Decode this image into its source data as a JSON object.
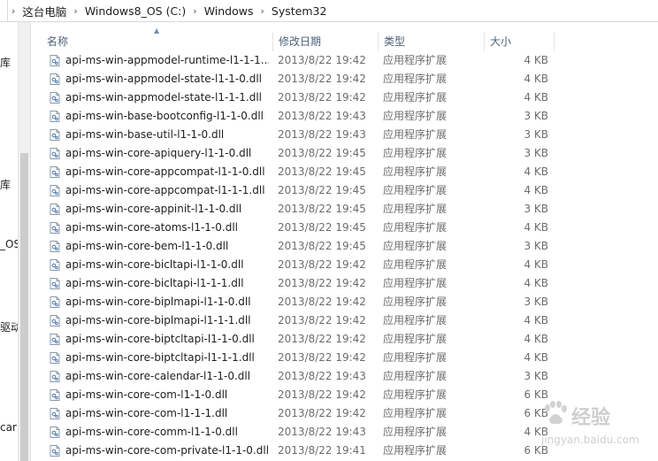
{
  "breadcrumb": [
    "这台电脑",
    "Windows8_OS (C:)",
    "Windows",
    "System32"
  ],
  "left_pane": [
    "库",
    "库",
    "_OS",
    "驱动",
    "car"
  ],
  "columns": {
    "name": "名称",
    "date": "修改日期",
    "type": "类型",
    "size": "大小"
  },
  "files": [
    {
      "name": "api-ms-win-appmodel-runtime-l1-1-1...",
      "date": "2013/8/22 19:42",
      "type": "应用程序扩展",
      "size": "4 KB"
    },
    {
      "name": "api-ms-win-appmodel-state-l1-1-0.dll",
      "date": "2013/8/22 19:42",
      "type": "应用程序扩展",
      "size": "4 KB"
    },
    {
      "name": "api-ms-win-appmodel-state-l1-1-1.dll",
      "date": "2013/8/22 19:42",
      "type": "应用程序扩展",
      "size": "4 KB"
    },
    {
      "name": "api-ms-win-base-bootconfig-l1-1-0.dll",
      "date": "2013/8/22 19:43",
      "type": "应用程序扩展",
      "size": "3 KB"
    },
    {
      "name": "api-ms-win-base-util-l1-1-0.dll",
      "date": "2013/8/22 19:43",
      "type": "应用程序扩展",
      "size": "3 KB"
    },
    {
      "name": "api-ms-win-core-apiquery-l1-1-0.dll",
      "date": "2013/8/22 19:45",
      "type": "应用程序扩展",
      "size": "3 KB"
    },
    {
      "name": "api-ms-win-core-appcompat-l1-1-0.dll",
      "date": "2013/8/22 19:45",
      "type": "应用程序扩展",
      "size": "4 KB"
    },
    {
      "name": "api-ms-win-core-appcompat-l1-1-1.dll",
      "date": "2013/8/22 19:45",
      "type": "应用程序扩展",
      "size": "4 KB"
    },
    {
      "name": "api-ms-win-core-appinit-l1-1-0.dll",
      "date": "2013/8/22 19:45",
      "type": "应用程序扩展",
      "size": "3 KB"
    },
    {
      "name": "api-ms-win-core-atoms-l1-1-0.dll",
      "date": "2013/8/22 19:45",
      "type": "应用程序扩展",
      "size": "4 KB"
    },
    {
      "name": "api-ms-win-core-bem-l1-1-0.dll",
      "date": "2013/8/22 19:45",
      "type": "应用程序扩展",
      "size": "3 KB"
    },
    {
      "name": "api-ms-win-core-bicltapi-l1-1-0.dll",
      "date": "2013/8/22 19:42",
      "type": "应用程序扩展",
      "size": "4 KB"
    },
    {
      "name": "api-ms-win-core-bicltapi-l1-1-1.dll",
      "date": "2013/8/22 19:42",
      "type": "应用程序扩展",
      "size": "4 KB"
    },
    {
      "name": "api-ms-win-core-biplmapi-l1-1-0.dll",
      "date": "2013/8/22 19:42",
      "type": "应用程序扩展",
      "size": "3 KB"
    },
    {
      "name": "api-ms-win-core-biplmapi-l1-1-1.dll",
      "date": "2013/8/22 19:42",
      "type": "应用程序扩展",
      "size": "4 KB"
    },
    {
      "name": "api-ms-win-core-biptcltapi-l1-1-0.dll",
      "date": "2013/8/22 19:42",
      "type": "应用程序扩展",
      "size": "4 KB"
    },
    {
      "name": "api-ms-win-core-biptcltapi-l1-1-1.dll",
      "date": "2013/8/22 19:42",
      "type": "应用程序扩展",
      "size": "4 KB"
    },
    {
      "name": "api-ms-win-core-calendar-l1-1-0.dll",
      "date": "2013/8/22 19:43",
      "type": "应用程序扩展",
      "size": "3 KB"
    },
    {
      "name": "api-ms-win-core-com-l1-1-0.dll",
      "date": "2013/8/22 19:42",
      "type": "应用程序扩展",
      "size": "6 KB"
    },
    {
      "name": "api-ms-win-core-com-l1-1-1.dll",
      "date": "2013/8/22 19:42",
      "type": "应用程序扩展",
      "size": "6 KB"
    },
    {
      "name": "api-ms-win-core-comm-l1-1-0.dll",
      "date": "2013/8/22 19:43",
      "type": "应用程序扩展",
      "size": "4 KB"
    },
    {
      "name": "api-ms-win-core-com-private-l1-1-0.dll",
      "date": "2013/8/22 19:41",
      "type": "应用程序扩展",
      "size": "6 KB"
    }
  ],
  "watermark": {
    "brand": "经验",
    "url": "jingyan.baidu.com"
  }
}
